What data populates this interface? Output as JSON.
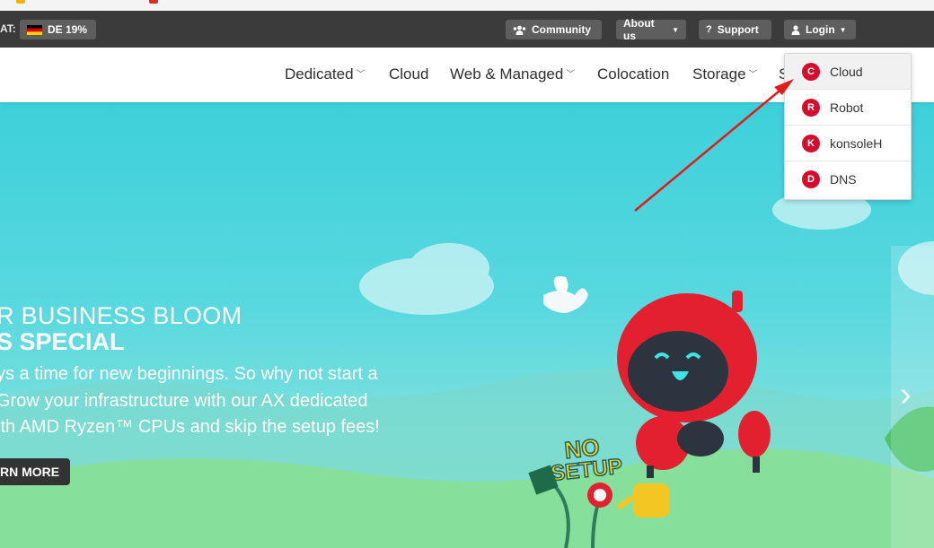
{
  "topbar": {
    "vat_label": "AT:",
    "vat_button": "DE 19%",
    "community": "Community",
    "about": "About us",
    "support": "Support",
    "login": "Login"
  },
  "nav": {
    "items": [
      {
        "label": "Dedicated",
        "has_chevron": true
      },
      {
        "label": "Cloud",
        "has_chevron": false
      },
      {
        "label": "Web & Managed",
        "has_chevron": true
      },
      {
        "label": "Colocation",
        "has_chevron": false
      },
      {
        "label": "Storage",
        "has_chevron": true
      },
      {
        "label": "S",
        "has_chevron": false
      }
    ]
  },
  "login_menu": {
    "items": [
      {
        "letter": "C",
        "label": "Cloud"
      },
      {
        "letter": "R",
        "label": "Robot"
      },
      {
        "letter": "K",
        "label": "konsoleH"
      },
      {
        "letter": "D",
        "label": "DNS"
      }
    ]
  },
  "hero": {
    "title_line1": "R BUSINESS BLOOM",
    "title_line2": "S SPECIAL",
    "copy": [
      "ys a time for new beginnings. So why not start a",
      "Grow your infrastructure with our AX dedicated",
      "ith AMD Ryzen™ CPUs and skip the setup fees!"
    ],
    "button": "RN MORE",
    "sign_text_1": "NO",
    "sign_text_2": "SETUP"
  },
  "colors": {
    "brand_red": "#d50c2d",
    "topbar_bg": "#3b3b3b",
    "hero_sky": "#4fd5dc",
    "annotation_arrow": "#e01b1b"
  },
  "icons": [
    "users-icon",
    "question-icon",
    "user-icon",
    "caret-down-icon",
    "chevron-down-icon",
    "chevron-right-icon"
  ]
}
